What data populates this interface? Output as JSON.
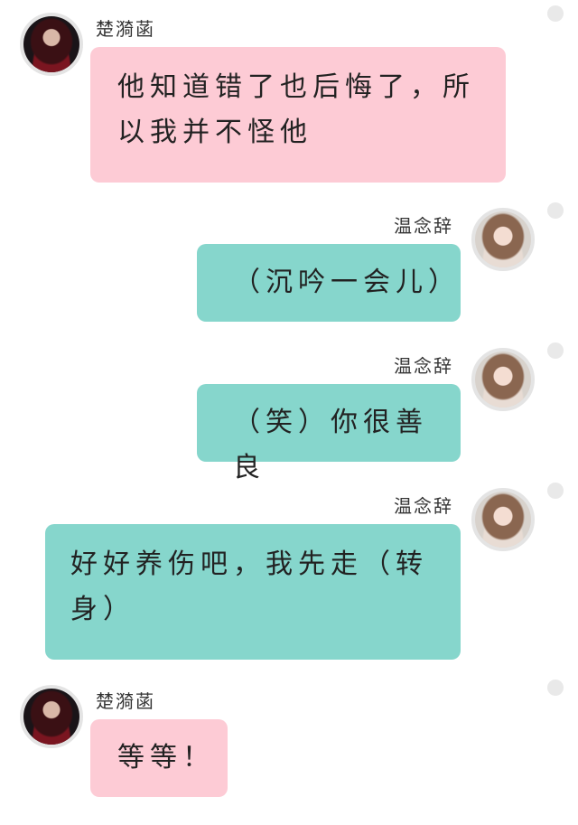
{
  "chat": {
    "messages": [
      {
        "sender": "楚漪菡",
        "side": "left",
        "color": "#fdcbd5",
        "text": "他知道错了也后悔了，所以我并不怪他"
      },
      {
        "sender": "温念辞",
        "side": "right",
        "color": "#86d6cc",
        "text": "（沉吟一会儿）"
      },
      {
        "sender": "温念辞",
        "side": "right",
        "color": "#86d6cc",
        "text": "（笑）你很善良"
      },
      {
        "sender": "温念辞",
        "side": "right",
        "color": "#86d6cc",
        "text": "好好养伤吧，我先走（转身）"
      },
      {
        "sender": "楚漪菡",
        "side": "left",
        "color": "#fdcbd5",
        "text": "等等！"
      }
    ]
  }
}
